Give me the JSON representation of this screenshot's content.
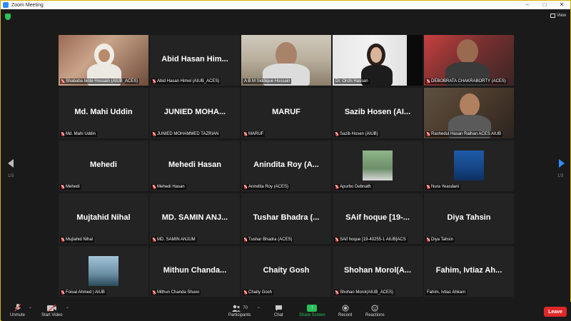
{
  "window": {
    "title": "Zoom Meeting"
  },
  "top": {
    "view_label": "View"
  },
  "pagination": {
    "left": "1/3",
    "right": "1/3"
  },
  "tiles": [
    {
      "name": "Shababa binte Hossain (AIUB_ACES)",
      "big": ""
    },
    {
      "name": "Abid Hasan Himel (AIUB_ACES)",
      "big": "Abid Hasan Him..."
    },
    {
      "name": "A B M Siddique Hossain",
      "big": ""
    },
    {
      "name": "Dr. Orchi Hassan",
      "big": ""
    },
    {
      "name": "DEBOBRATA CHAKRABORTY (ACES)",
      "big": ""
    },
    {
      "name": "Md. Mahi Uddin",
      "big": "Md. Mahi Uddin"
    },
    {
      "name": "JUNIED MOHAMMED TAZRIAN",
      "big": "JUNIED MOHA..."
    },
    {
      "name": "MARUF",
      "big": "MARUF"
    },
    {
      "name": "Sazib Hosen (AIUB)",
      "big": "Sazib Hosen (AI..."
    },
    {
      "name": "Rashedul Hasan Raihan ACES AIUB",
      "big": ""
    },
    {
      "name": "Mehedi",
      "big": "Mehedi"
    },
    {
      "name": "Mehedi Hasan",
      "big": "Mehedi Hasan"
    },
    {
      "name": "Anindita Roy (ACES)",
      "big": "Anindita Roy (A..."
    },
    {
      "name": "Apurbo Debnath",
      "big": ""
    },
    {
      "name": "Nura Yeasdani",
      "big": ""
    },
    {
      "name": "Mujtahid Nihal",
      "big": "Mujtahid Nihal"
    },
    {
      "name": "MD. SAMIN ANJUM",
      "big": "MD. SAMIN ANJ..."
    },
    {
      "name": "Tushar Bhadra (ACES)",
      "big": "Tushar Bhadra (..."
    },
    {
      "name": "SAif hoque [19-40255-1 AIUB]ACS",
      "big": "SAif hoque [19-..."
    },
    {
      "name": "Diya Tahsin",
      "big": "Diya Tahsin"
    },
    {
      "name": "Foisal Ahmed | AIUB",
      "big": ""
    },
    {
      "name": "Mithun Chanda Shuvo",
      "big": "Mithun Chanda..."
    },
    {
      "name": "Chaity Gosh",
      "big": "Chaity Gosh"
    },
    {
      "name": "Shohan Morol(AIUB_ACES)",
      "big": "Shohan Morol(A..."
    },
    {
      "name": "Fahim, Ivtiaz Ahkam",
      "big": "Fahim, Ivtiaz Ah..."
    }
  ],
  "toolbar": {
    "unmute": "Unmute",
    "start_video": "Start Video",
    "participants": "Participants",
    "participants_count": "70",
    "chat": "Chat",
    "share_screen": "Share Screen",
    "record": "Record",
    "reactions": "Reactions",
    "leave": "Leave"
  },
  "colors": {
    "accent": "#2d8cff",
    "share": "#2bbf5a",
    "leave": "#e02828",
    "active_speaker": "#c8e07a"
  }
}
